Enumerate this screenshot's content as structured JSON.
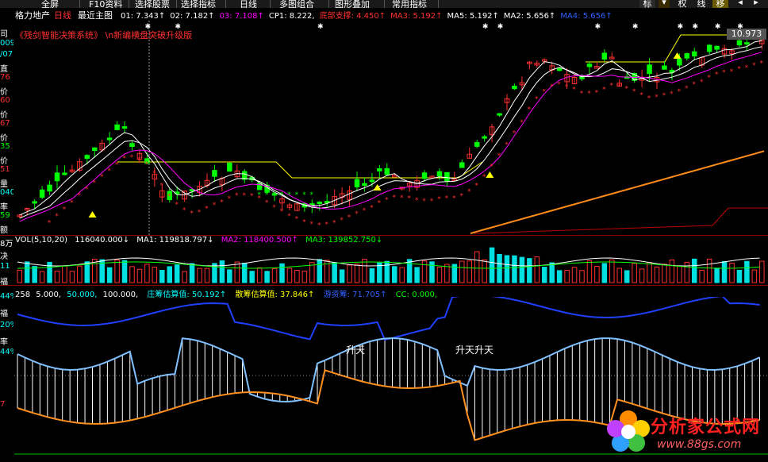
{
  "toolbar": {
    "items": [
      "全屏",
      "F10资料",
      "选择股票",
      "选择指标",
      "日线",
      "多图组合",
      "图形叠加",
      "常用指标"
    ],
    "right_buttons": [
      "标",
      "权",
      "线",
      "移"
    ]
  },
  "header": {
    "stock": "格力地产",
    "period": "日线",
    "chart_name": "最近主图",
    "indicators": [
      {
        "label": "01: 7.343↑",
        "color": "#ffffff"
      },
      {
        "label": "02: 7.182↑",
        "color": "#ffffff"
      },
      {
        "label": "03: 7.108↑",
        "color": "#ff00ff"
      },
      {
        "label": "CP1: 8.222,",
        "color": "#ffffff"
      },
      {
        "label": "底部支撑: 4.450↑",
        "color": "#ff3030"
      },
      {
        "label": "MA3: 5.192↑",
        "color": "#ff3030"
      },
      {
        "label": "MA5: 5.192↑",
        "color": "#ffffff"
      },
      {
        "label": "MA2: 5.656↑",
        "color": "#ffffff"
      },
      {
        "label": "MA4: 5.656↑",
        "color": "#3060ff"
      }
    ],
    "subtitle": "《残剑智能决策系统》 \\n新编横盘突破升级版",
    "price_tag": "10.973"
  },
  "left_axis": [
    {
      "text": "司",
      "color": "#ffffff"
    },
    {
      "text": "009",
      "color": "#00ffff"
    },
    {
      "text": "/07",
      "color": "#00ffff"
    },
    {
      "text": "直",
      "color": "#ffffff"
    },
    {
      "text": "76",
      "color": "#ff3030"
    },
    {
      "text": "价",
      "color": "#ffffff"
    },
    {
      "text": "60",
      "color": "#ff3030"
    },
    {
      "text": "价",
      "color": "#ffffff"
    },
    {
      "text": "67",
      "color": "#ff3030"
    },
    {
      "text": "价",
      "color": "#ffffff"
    },
    {
      "text": "35",
      "color": "#00ff00"
    },
    {
      "text": "价",
      "color": "#ffffff"
    },
    {
      "text": "51",
      "color": "#ff3030"
    },
    {
      "text": "量",
      "color": "#ffffff"
    },
    {
      "text": "040",
      "color": "#00ffff"
    },
    {
      "text": "率",
      "color": "#ffffff"
    },
    {
      "text": "59",
      "color": "#00ff00"
    },
    {
      "text": "额",
      "color": "#ffffff"
    }
  ],
  "vol_panel": {
    "title": "VOL(5,10,20)",
    "value": "116040.000↓",
    "ma1": "MA1: 119818.797↓",
    "ma2": "MA2: 118400.500↑",
    "ma3": "MA3: 139852.750↓",
    "left_labels": [
      "8万",
      "决",
      "11",
      "福"
    ]
  },
  "lower_panel": {
    "params": "258",
    "p1": "5.000,",
    "p2": "50.000,",
    "p3": "100.000,",
    "ind1": "庄筹估算值: 50.192↑",
    "ind2": "散筹估算值: 37.846↑",
    "ind3": "游资筹: 71.705↑",
    "ind4": "CC: 0.000,",
    "left_labels": [
      "44%",
      "福",
      "20%",
      "率",
      "44%",
      "7"
    ],
    "annotation1": "升天",
    "annotation2": "升天升天"
  },
  "watermark": {
    "title": "分析家公式网",
    "url": "www.88gs.com"
  },
  "colors": {
    "up": "#ff3030",
    "down": "#00ff00",
    "vol_down": "#00e0e0",
    "ma_white": "#ffffff",
    "ma_yellow": "#ffff00",
    "ma_magenta": "#ff00ff",
    "ma_orange": "#ff8c1a",
    "line_blue": "#2040ff",
    "line_cyan": "#80c0ff",
    "line_orange": "#ff9020"
  }
}
